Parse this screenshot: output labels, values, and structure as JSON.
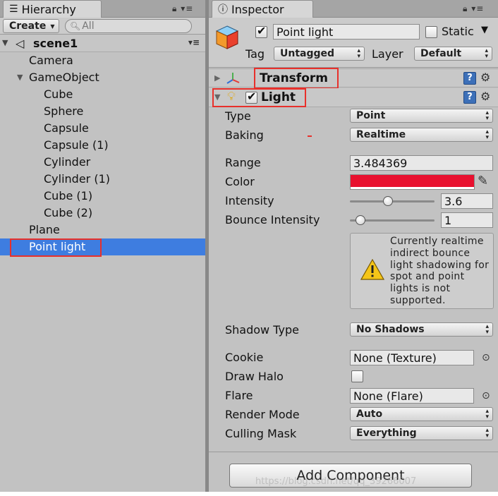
{
  "hierarchy": {
    "tab_title": "Hierarchy",
    "create_label": "Create",
    "search_placeholder": "All",
    "scene_name": "scene1",
    "items": [
      {
        "label": "Camera",
        "indent": 1
      },
      {
        "label": "GameObject",
        "indent": 1,
        "expanded": true
      },
      {
        "label": "Cube",
        "indent": 2
      },
      {
        "label": "Sphere",
        "indent": 2
      },
      {
        "label": "Capsule",
        "indent": 2
      },
      {
        "label": "Capsule (1)",
        "indent": 2
      },
      {
        "label": "Cylinder",
        "indent": 2
      },
      {
        "label": "Cylinder (1)",
        "indent": 2
      },
      {
        "label": "Cube (1)",
        "indent": 2
      },
      {
        "label": "Cube (2)",
        "indent": 2
      },
      {
        "label": "Plane",
        "indent": 1
      },
      {
        "label": "Point light",
        "indent": 1,
        "selected": true
      }
    ]
  },
  "inspector": {
    "tab_title": "Inspector",
    "object_name": "Point light",
    "static_label": "Static",
    "tag_label": "Tag",
    "tag_value": "Untagged",
    "layer_label": "Layer",
    "layer_value": "Default",
    "transform_label": "Transform",
    "light_label": "Light",
    "type_label": "Type",
    "type_value": "Point",
    "baking_label": "Baking",
    "baking_value": "Realtime",
    "range_label": "Range",
    "range_value": "3.484369",
    "color_label": "Color",
    "color_value": "#e8102e",
    "intensity_label": "Intensity",
    "intensity_value": "3.6",
    "intensity_fraction": 0.45,
    "bounce_label": "Bounce Intensity",
    "bounce_value": "1",
    "bounce_fraction": 0.125,
    "warning_text": "Currently realtime indirect bounce light shadowing for spot and point lights is not supported.",
    "shadow_type_label": "Shadow Type",
    "shadow_type_value": "No Shadows",
    "cookie_label": "Cookie",
    "cookie_value": "None (Texture)",
    "draw_halo_label": "Draw Halo",
    "flare_label": "Flare",
    "flare_value": "None (Flare)",
    "render_mode_label": "Render Mode",
    "render_mode_value": "Auto",
    "culling_mask_label": "Culling Mask",
    "culling_mask_value": "Everything",
    "add_component_label": "Add Component"
  },
  "watermark": "https://blog.csdn.net/qq_39266007",
  "colors": {
    "selection": "#3e7de0",
    "highlight_box": "#e8302b",
    "light_color": "#e8102e"
  }
}
